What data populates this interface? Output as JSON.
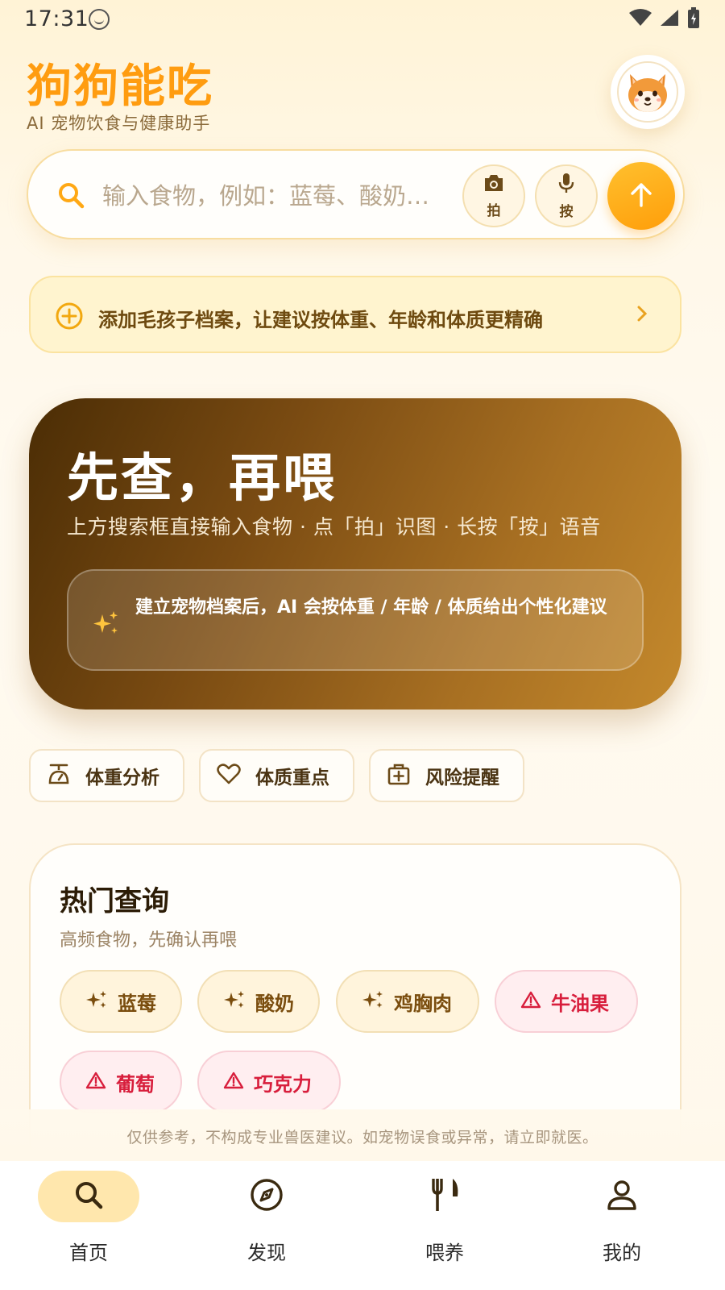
{
  "status_bar": {
    "time": "17:31"
  },
  "header": {
    "title": "狗狗能吃",
    "subtitle": "AI 宠物饮食与健康助手",
    "avatar_icon": "shiba-dog-avatar"
  },
  "search": {
    "placeholder": "输入食物，例如：蓝莓、酸奶…",
    "value": "",
    "camera_label": "拍",
    "voice_label": "按",
    "submit_icon": "arrow-up-icon"
  },
  "profile_banner": {
    "text": "添加毛孩子档案，让建议按体重、年龄和体质更精确"
  },
  "hero": {
    "title": "先查，再喂",
    "subtitle": "上方搜索框直接输入食物 · 点「拍」识图 · 长按「按」语音",
    "tip": "建立宠物档案后，AI 会按体重 / 年龄 / 体质给出个性化建议"
  },
  "feature_chips": [
    {
      "label": "体重分析",
      "icon": "scale-icon"
    },
    {
      "label": "体质重点",
      "icon": "heart-icon"
    },
    {
      "label": "风险提醒",
      "icon": "medkit-icon"
    }
  ],
  "hot": {
    "title": "热门查询",
    "subtitle": "高频食物，先确认再喂",
    "items": [
      {
        "label": "蓝莓",
        "status": "safe"
      },
      {
        "label": "酸奶",
        "status": "safe"
      },
      {
        "label": "鸡胸肉",
        "status": "safe"
      },
      {
        "label": "牛油果",
        "status": "danger"
      },
      {
        "label": "葡萄",
        "status": "danger"
      },
      {
        "label": "巧克力",
        "status": "danger"
      }
    ]
  },
  "disclaimer": "仅供参考，不构成专业兽医建议。如宠物误食或异常，请立即就医。",
  "nav": [
    {
      "label": "首页",
      "icon": "search-icon",
      "active": true
    },
    {
      "label": "发现",
      "icon": "compass-icon",
      "active": false
    },
    {
      "label": "喂养",
      "icon": "fork-knife-icon",
      "active": false
    },
    {
      "label": "我的",
      "icon": "person-icon",
      "active": false
    }
  ],
  "colors": {
    "accent": "#ff9c10",
    "danger": "#d81e3c",
    "hero_dark": "#4b2d05",
    "hero_light": "#c4892c"
  }
}
